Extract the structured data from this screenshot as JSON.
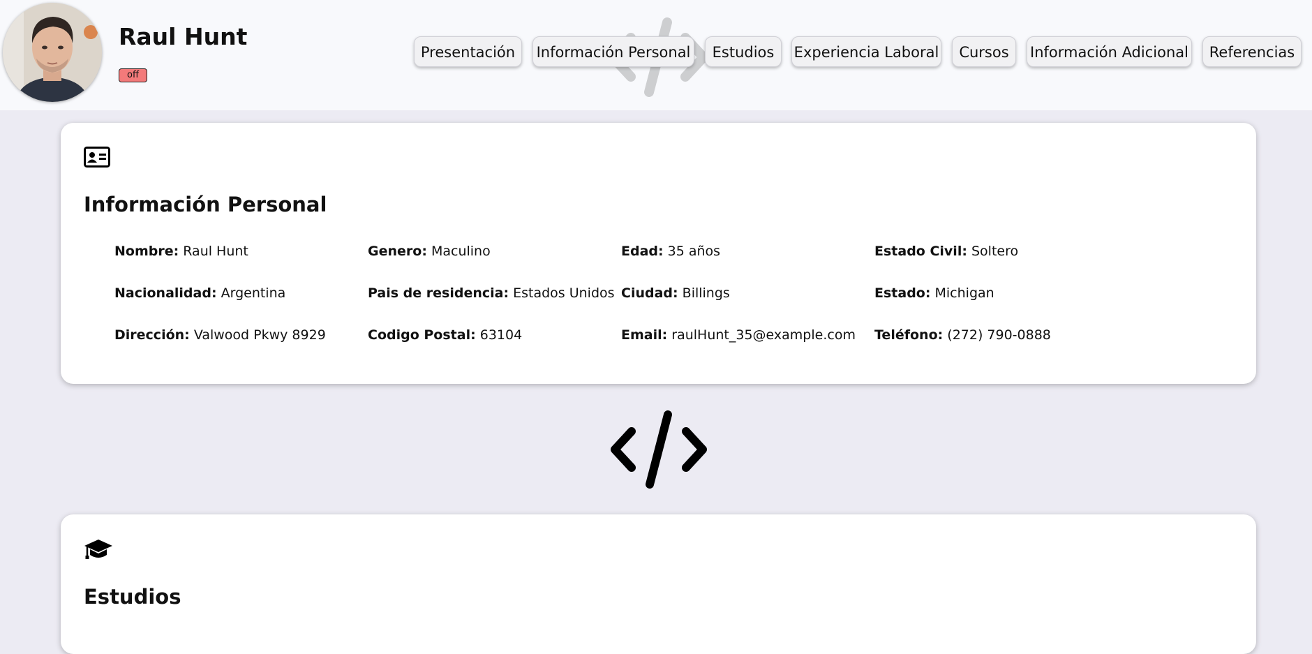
{
  "profile": {
    "name": "Raul Hunt",
    "status": "off"
  },
  "nav": {
    "items": [
      {
        "label": "Presentación"
      },
      {
        "label": "Información Personal"
      },
      {
        "label": "Estudios"
      },
      {
        "label": "Experiencia Laboral"
      },
      {
        "label": "Cursos"
      },
      {
        "label": "Información Adicional"
      },
      {
        "label": "Referencias"
      }
    ]
  },
  "personal": {
    "icon": "id-card-icon",
    "title": "Información Personal",
    "fields": [
      {
        "label": "Nombre:",
        "value": "Raul Hunt"
      },
      {
        "label": "Genero:",
        "value": "Maculino"
      },
      {
        "label": "Edad:",
        "value": "35 años"
      },
      {
        "label": "Estado Civil:",
        "value": "Soltero"
      },
      {
        "label": "Nacionalidad:",
        "value": "Argentina"
      },
      {
        "label": "Pais de residencia:",
        "value": "Estados Unidos"
      },
      {
        "label": "Ciudad:",
        "value": "Billings"
      },
      {
        "label": "Estado:",
        "value": "Michigan"
      },
      {
        "label": "Dirección:",
        "value": "Valwood Pkwy 8929"
      },
      {
        "label": "Codigo Postal:",
        "value": "63104"
      },
      {
        "label": "Email:",
        "value": "raulHunt_35@example.com"
      },
      {
        "label": "Teléfono:",
        "value": "(272) 790-0888"
      }
    ]
  },
  "studies": {
    "icon": "graduation-cap-icon",
    "title": "Estudios"
  },
  "colors": {
    "background": "#ecebf3",
    "header": "#f8f9fc",
    "badge": "#f37a7a"
  }
}
